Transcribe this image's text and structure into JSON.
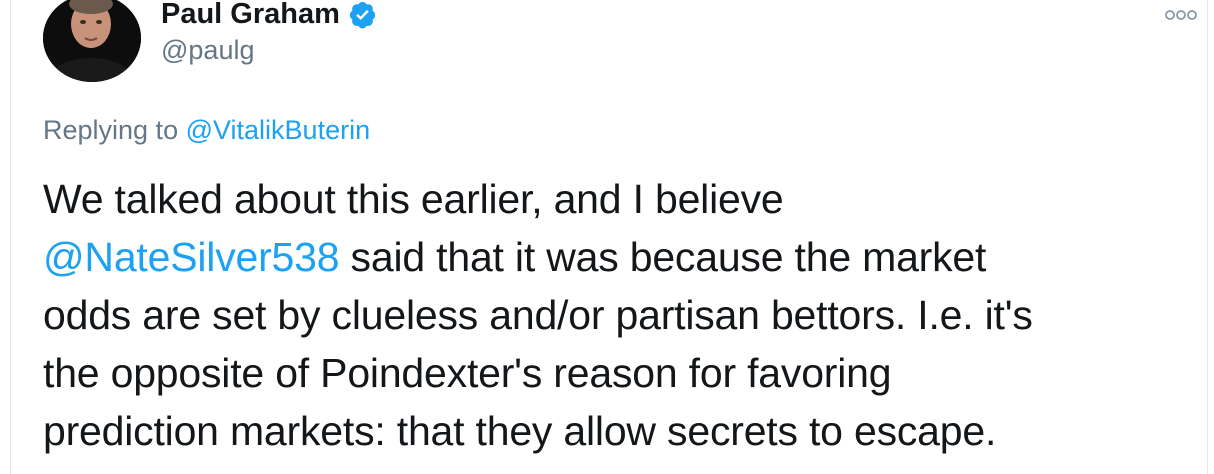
{
  "author": {
    "display_name": "Paul Graham",
    "handle": "@paulg",
    "verified": true
  },
  "more_icon": "more-options-icon",
  "reply_context": {
    "prefix": "Replying to",
    "mention": "@VitalikButerin"
  },
  "tweet": {
    "line1": "We talked about this earlier, and I believe",
    "line2_mention": "@NateSilver538",
    "line2_rest": " said that it was because the market",
    "line3": "odds are set by clueless and/or partisan bettors. I.e. it's",
    "line4": "the opposite of Poindexter's reason for favoring",
    "line5": "prediction markets: that they allow secrets to escape."
  },
  "colors": {
    "link": "#1da1f2",
    "secondary_text": "#657786",
    "primary_text": "#14171a",
    "verified": "#1da1f2"
  }
}
